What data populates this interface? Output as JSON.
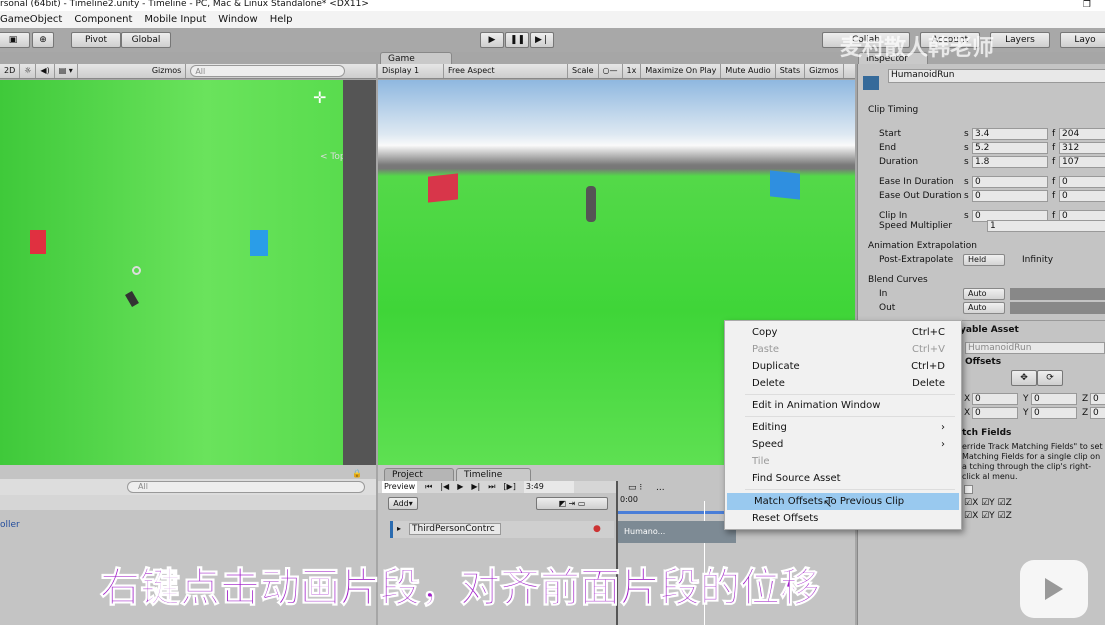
{
  "window": {
    "title": "rsonal (64bit) - Timeline2.unity - Timeline - PC, Mac & Linux Standalone* <DX11>"
  },
  "menu": [
    "GameObject",
    "Component",
    "Mobile Input",
    "Window",
    "Help"
  ],
  "toolbar": {
    "pivot": "Pivot",
    "global": "Global",
    "collab": "Collab",
    "account": "Account",
    "layers": "Layers",
    "layout": "Layo"
  },
  "scene": {
    "mode_2d": "2D",
    "gizmos": "Gizmos",
    "search_placeholder": "All",
    "view_label": "< Top"
  },
  "game": {
    "tab": "Game",
    "display": "Display 1",
    "aspect": "Free Aspect",
    "scale_label": "Scale",
    "scale_value": "1x",
    "maximize": "Maximize On Play",
    "mute": "Mute Audio",
    "stats": "Stats",
    "gizmos": "Gizmos"
  },
  "inspector": {
    "tab": "Inspector",
    "name": "HumanoidRun",
    "clip_timing": "Clip Timing",
    "rows": [
      {
        "label": "Start",
        "s": "3.4",
        "f": "204"
      },
      {
        "label": "End",
        "s": "5.2",
        "f": "312"
      },
      {
        "label": "Duration",
        "s": "1.8",
        "f": "107"
      },
      {
        "label": "Ease In Duration",
        "s": "0",
        "f": "0"
      },
      {
        "label": "Ease Out Duration",
        "s": "0",
        "f": "0"
      },
      {
        "label": "Clip In",
        "s": "0",
        "f": "0"
      }
    ],
    "s_unit": "s",
    "f_unit": "f",
    "speed_label": "Speed Multiplier",
    "speed_value": "1",
    "extrap_header": "Animation Extrapolation",
    "post_label": "Post-Extrapolate",
    "post_value": "Held",
    "post_info": "Infinity",
    "blend_header": "Blend Curves",
    "blend_in": "In",
    "blend_out": "Out",
    "blend_in_value": "Auto",
    "blend_out_value": "Auto",
    "asset_header": "yable Asset",
    "asset_value": "HumanoidRun",
    "offsets": "Offsets",
    "pos": {
      "x": "0",
      "y": "0",
      "z": "0"
    },
    "rot": {
      "x": "0",
      "y": "0",
      "z": "0"
    },
    "match_fields": "tch Fields",
    "help": "erride Track Matching Fields\" to set Matching Fields for a single clip on a tching through the clip's right-click al menu.",
    "axes": [
      "X",
      "Y",
      "Z"
    ]
  },
  "hierarchy": {
    "search_placeholder": "All",
    "item": "oller"
  },
  "timeline": {
    "project_tab": "Project",
    "timeline_tab": "Timeline",
    "preview": "Preview",
    "time": "3:49",
    "add": "Add",
    "ruler_start": "0:00",
    "more": "...",
    "track": "ThirdPersonContrc",
    "clip": "Humano..."
  },
  "context_menu": [
    {
      "label": "Copy",
      "shortcut": "Ctrl+C"
    },
    {
      "label": "Paste",
      "shortcut": "Ctrl+V",
      "disabled": true
    },
    {
      "label": "Duplicate",
      "shortcut": "Ctrl+D"
    },
    {
      "label": "Delete",
      "shortcut": "Delete"
    },
    {
      "label": "Edit in Animation Window"
    },
    {
      "label": "Editing",
      "submenu": true
    },
    {
      "label": "Speed",
      "submenu": true
    },
    {
      "label": "Tile",
      "disabled": true
    },
    {
      "label": "Find Source Asset"
    },
    {
      "label": "Match Offsets To Previous Clip",
      "highlighted": true
    },
    {
      "label": "Reset Offsets"
    }
  ],
  "overlay": {
    "caption": "右键点击动画片段，对齐前面片段的位移",
    "watermark": "麦村散人韩老师",
    "logo": "bilibili"
  },
  "colors": {
    "caption": "#a020c8",
    "highlight": "#99c9ef",
    "ground": "#4fd845"
  }
}
